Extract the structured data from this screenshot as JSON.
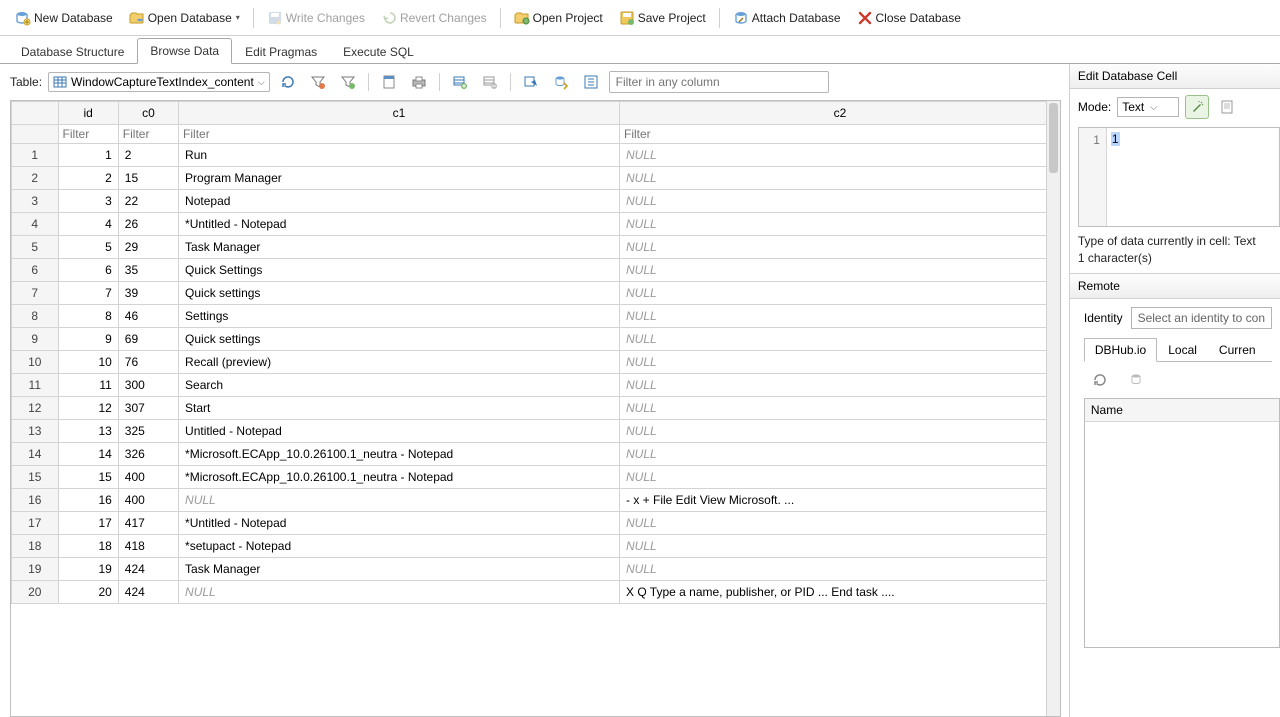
{
  "toolbar": {
    "new_db": "New Database",
    "open_db": "Open Database",
    "write_changes": "Write Changes",
    "revert_changes": "Revert Changes",
    "open_project": "Open Project",
    "save_project": "Save Project",
    "attach_db": "Attach Database",
    "close_db": "Close Database"
  },
  "tabs": {
    "structure": "Database Structure",
    "browse": "Browse Data",
    "pragmas": "Edit Pragmas",
    "sql": "Execute SQL"
  },
  "browse": {
    "table_label": "Table:",
    "table_selected": "WindowCaptureTextIndex_content",
    "filter_any_placeholder": "Filter in any column",
    "col_filter_placeholder": "Filter",
    "columns": {
      "rownum": "",
      "id": "id",
      "c0": "c0",
      "c1": "c1",
      "c2": "c2"
    }
  },
  "rows": [
    {
      "n": "1",
      "id": "1",
      "c0": "2",
      "c1": "Run",
      "c2": null
    },
    {
      "n": "2",
      "id": "2",
      "c0": "15",
      "c1": "Program Manager",
      "c2": null
    },
    {
      "n": "3",
      "id": "3",
      "c0": "22",
      "c1": "Notepad",
      "c2": null
    },
    {
      "n": "4",
      "id": "4",
      "c0": "26",
      "c1": "*Untitled - Notepad",
      "c2": null
    },
    {
      "n": "5",
      "id": "5",
      "c0": "29",
      "c1": "Task Manager",
      "c2": null
    },
    {
      "n": "6",
      "id": "6",
      "c0": "35",
      "c1": "Quick Settings",
      "c2": null
    },
    {
      "n": "7",
      "id": "7",
      "c0": "39",
      "c1": "Quick settings",
      "c2": null
    },
    {
      "n": "8",
      "id": "8",
      "c0": "46",
      "c1": "Settings",
      "c2": null
    },
    {
      "n": "9",
      "id": "9",
      "c0": "69",
      "c1": "Quick settings",
      "c2": null
    },
    {
      "n": "10",
      "id": "10",
      "c0": "76",
      "c1": "Recall (preview)",
      "c2": null
    },
    {
      "n": "11",
      "id": "11",
      "c0": "300",
      "c1": "Search",
      "c2": null
    },
    {
      "n": "12",
      "id": "12",
      "c0": "307",
      "c1": "Start",
      "c2": null
    },
    {
      "n": "13",
      "id": "13",
      "c0": "325",
      "c1": "Untitled - Notepad",
      "c2": null
    },
    {
      "n": "14",
      "id": "14",
      "c0": "326",
      "c1": "*Microsoft.ECApp_10.0.26100.1_neutra - Notepad",
      "c2": null
    },
    {
      "n": "15",
      "id": "15",
      "c0": "400",
      "c1": "*Microsoft.ECApp_10.0.26100.1_neutra - Notepad",
      "c2": null
    },
    {
      "n": "16",
      "id": "16",
      "c0": "400",
      "c1": null,
      "c2": "- x + File Edit View Microsoft. ..."
    },
    {
      "n": "17",
      "id": "17",
      "c0": "417",
      "c1": "*Untitled - Notepad",
      "c2": null
    },
    {
      "n": "18",
      "id": "18",
      "c0": "418",
      "c1": "*setupact - Notepad",
      "c2": null
    },
    {
      "n": "19",
      "id": "19",
      "c0": "424",
      "c1": "Task Manager",
      "c2": null
    },
    {
      "n": "20",
      "id": "20",
      "c0": "424",
      "c1": null,
      "c2": "X Q Type a name, publisher, or PID ... End task ...."
    }
  ],
  "null_text": "NULL",
  "cell_editor": {
    "title": "Edit Database Cell",
    "mode_label": "Mode:",
    "mode_value": "Text",
    "gutter_line": "1",
    "content": "1",
    "meta_type": "Type of data currently in cell: Text",
    "meta_len": "1 character(s)"
  },
  "remote": {
    "title": "Remote",
    "identity_label": "Identity",
    "identity_placeholder": "Select an identity to con",
    "tabs": {
      "dbhub": "DBHub.io",
      "local": "Local",
      "current": "Curren"
    },
    "list_header": "Name"
  }
}
